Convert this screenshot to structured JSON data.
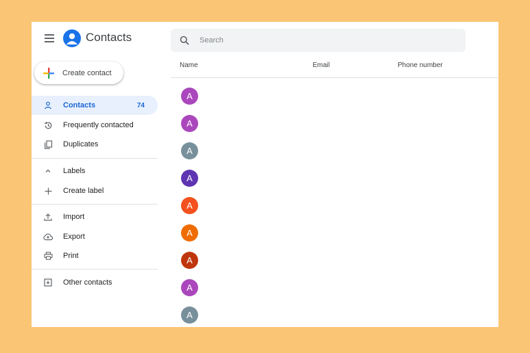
{
  "app": {
    "title": "Contacts"
  },
  "sidebar": {
    "create_label": "Create contact",
    "items": [
      {
        "label": "Contacts",
        "count": "74"
      },
      {
        "label": "Frequently contacted"
      },
      {
        "label": "Duplicates"
      },
      {
        "label": "Labels"
      },
      {
        "label": "Create label"
      },
      {
        "label": "Import"
      },
      {
        "label": "Export"
      },
      {
        "label": "Print"
      },
      {
        "label": "Other contacts"
      }
    ]
  },
  "search": {
    "placeholder": "Search",
    "value": ""
  },
  "table": {
    "columns": [
      "Name",
      "Email",
      "Phone number"
    ],
    "rows": [
      {
        "initial": "A",
        "color": "#ab47bc"
      },
      {
        "initial": "A",
        "color": "#ab47bc"
      },
      {
        "initial": "A",
        "color": "#78909c"
      },
      {
        "initial": "A",
        "color": "#5e35b1"
      },
      {
        "initial": "A",
        "color": "#f4511e"
      },
      {
        "initial": "A",
        "color": "#ef6c00"
      },
      {
        "initial": "A",
        "color": "#bf360c"
      },
      {
        "initial": "A",
        "color": "#ab47bc"
      },
      {
        "initial": "A",
        "color": "#78909c"
      }
    ]
  },
  "colors": {
    "accent": "#1a73e8",
    "active_bg": "#e8f0fe",
    "active_text": "#1967d2",
    "frame_bg": "#fac574"
  }
}
